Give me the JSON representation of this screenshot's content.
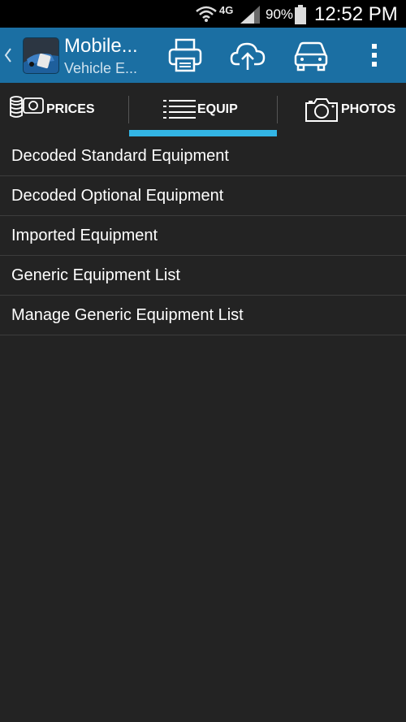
{
  "status_bar": {
    "network": "4G",
    "battery_percent": "90%",
    "time": "12:52 PM"
  },
  "action_bar": {
    "title": "Mobile...",
    "subtitle": "Vehicle E...",
    "icons": [
      "print-icon",
      "cloud-upload-icon",
      "car-icon",
      "overflow-menu-icon"
    ]
  },
  "tabs": [
    {
      "label": "PRICES",
      "icon": "prices-icon",
      "selected": false
    },
    {
      "label": "EQUIP",
      "icon": "list-icon",
      "selected": true
    },
    {
      "label": "PHOTOS",
      "icon": "camera-icon",
      "selected": false
    }
  ],
  "equipment_list": [
    {
      "label": "Decoded Standard Equipment"
    },
    {
      "label": "Decoded Optional Equipment"
    },
    {
      "label": "Imported Equipment"
    },
    {
      "label": "Generic Equipment List"
    },
    {
      "label": "Manage Generic Equipment List"
    }
  ],
  "colors": {
    "action_bar": "#1b6fa3",
    "background": "#232323",
    "tab_indicator": "#33b5e5"
  }
}
